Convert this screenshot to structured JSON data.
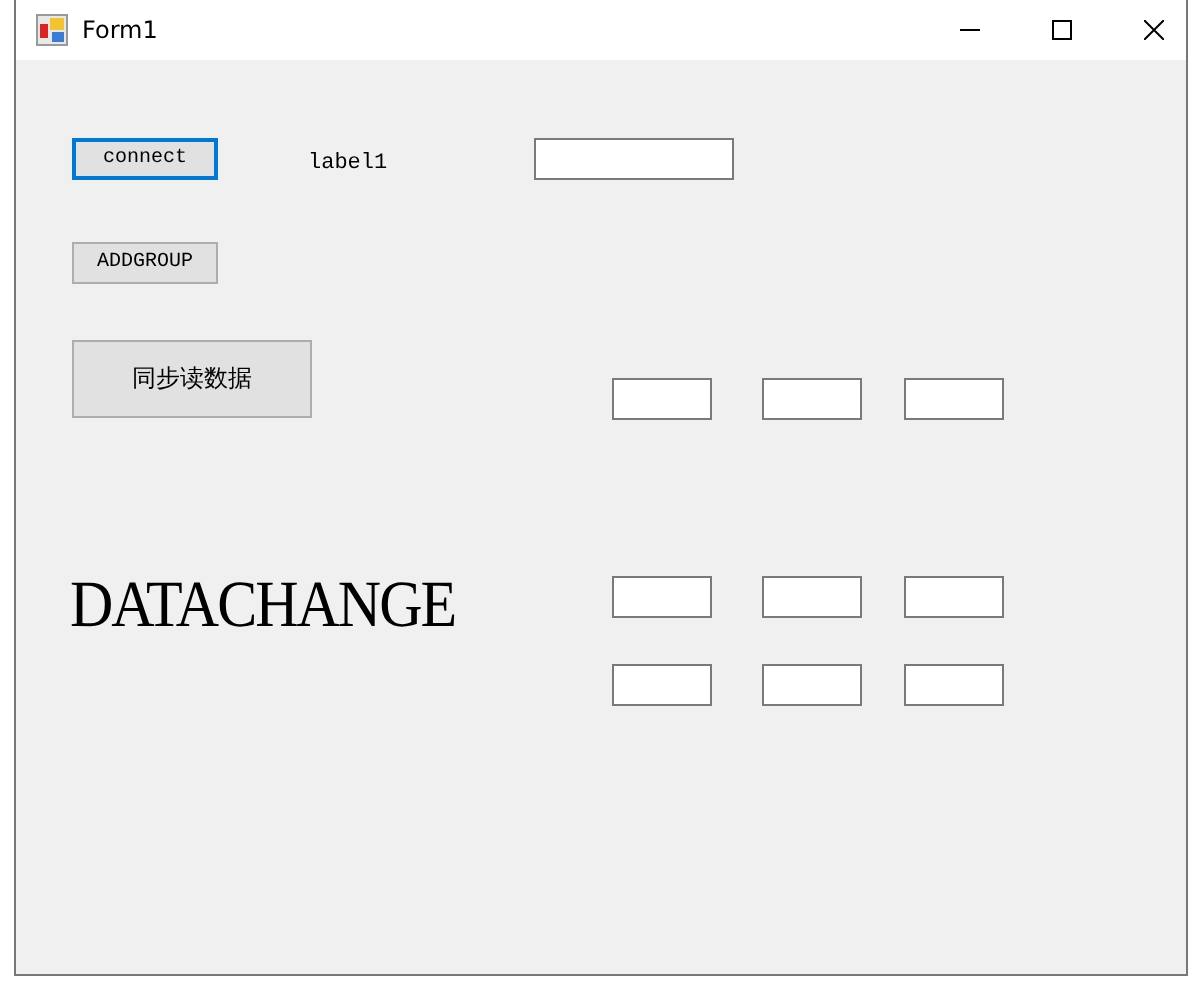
{
  "window": {
    "title": "Form1"
  },
  "buttons": [
    {
      "label": "connect",
      "focused": true,
      "kind": "small"
    },
    {
      "label": "ADDGROUP",
      "focused": false,
      "kind": "small"
    },
    {
      "label": "同步读数据",
      "focused": false,
      "kind": "large"
    }
  ],
  "label": "label1",
  "heading": "DATACHANGE",
  "text_fields": [
    {
      "kind": "wide"
    },
    {
      "kind": "small"
    },
    {
      "kind": "small"
    },
    {
      "kind": "small"
    },
    {
      "kind": "small"
    },
    {
      "kind": "small"
    },
    {
      "kind": "small"
    },
    {
      "kind": "small"
    },
    {
      "kind": "small"
    },
    {
      "kind": "small"
    }
  ]
}
